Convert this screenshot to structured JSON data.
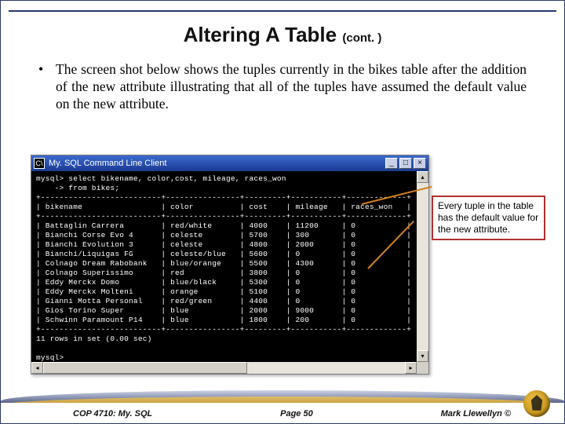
{
  "title": {
    "main": "Altering A Table",
    "cont": "(cont. )"
  },
  "body_text": "The screen shot below shows the tuples currently in the bikes table after the addition of the new attribute illustrating that all of the tuples have assumed the default value on the new attribute.",
  "console_window": {
    "title": "My. SQL Command Line Client",
    "query_line1": "mysql> select bikename, color,cost, mileage, races_won",
    "query_line2": "    -> from bikes;",
    "headers": [
      "bikename",
      "color",
      "cost",
      "mileage",
      "races_won"
    ],
    "rows": [
      [
        "Battaglin Carrera",
        "red/white",
        "4000",
        "11200",
        "0"
      ],
      [
        "Bianchi Corse Evo 4",
        "celeste",
        "5700",
        "300",
        "0"
      ],
      [
        "Bianchi Evolution 3",
        "celeste",
        "4800",
        "2000",
        "0"
      ],
      [
        "Bianchi/Liquigas FG",
        "celeste/blue",
        "5600",
        "0",
        "0"
      ],
      [
        "Colnago Dream Rabobank",
        "blue/orange",
        "5500",
        "4300",
        "0"
      ],
      [
        "Colnago Superissimo",
        "red",
        "3800",
        "0",
        "0"
      ],
      [
        "Eddy Merckx Domo",
        "blue/black",
        "5300",
        "0",
        "0"
      ],
      [
        "Eddy Merckx Molteni",
        "orange",
        "5100",
        "0",
        "0"
      ],
      [
        "Gianni Motta Personal",
        "red/green",
        "4400",
        "0",
        "0"
      ],
      [
        "Gios Torino Super",
        "blue",
        "2000",
        "9000",
        "0"
      ],
      [
        "Schwinn Paramount P14",
        "blue",
        "1800",
        "200",
        "0"
      ]
    ],
    "summary": "11 rows in set (0.00 sec)",
    "prompt": "mysql>"
  },
  "callout": "Every tuple in the table has the default value for the new attribute.",
  "footer": {
    "left": "COP 4710: My. SQL",
    "center": "Page 50",
    "right": "Mark Llewellyn ©"
  }
}
